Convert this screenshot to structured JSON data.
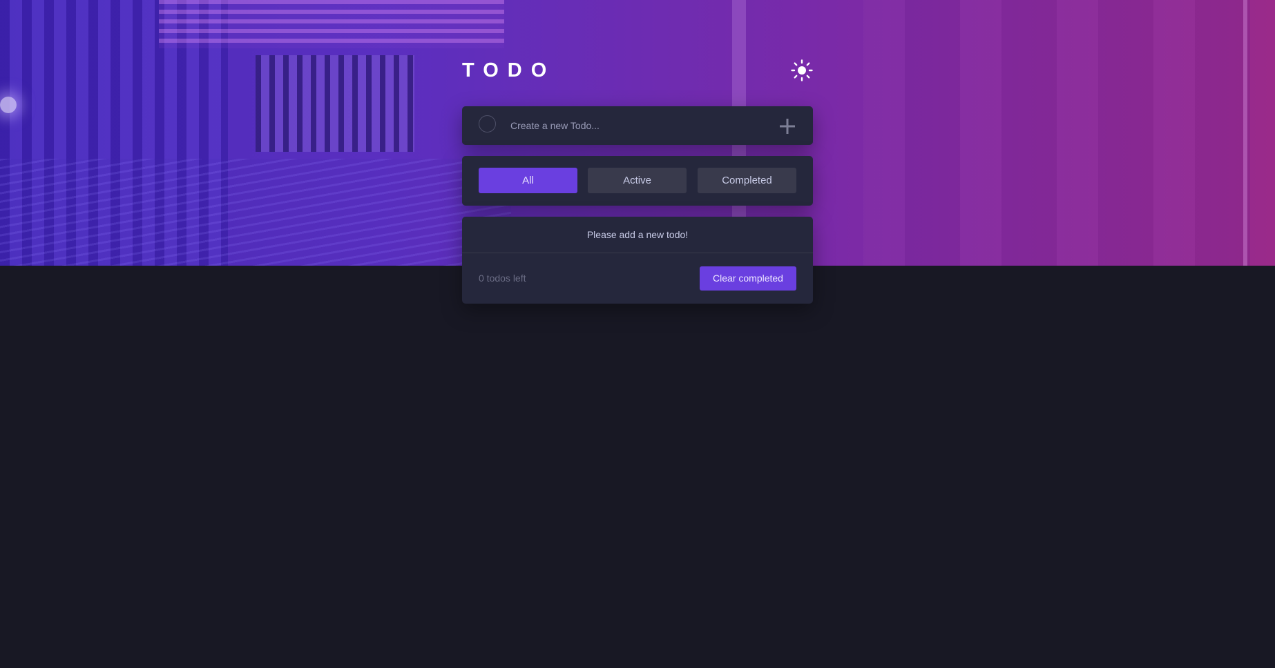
{
  "app": {
    "title": "TODO",
    "theme_toggle_icon": "sun-icon"
  },
  "new_todo": {
    "placeholder": "Create a new Todo...",
    "value": "",
    "add_icon": "plus-icon"
  },
  "filters": {
    "items": [
      {
        "label": "All",
        "active": true
      },
      {
        "label": "Active",
        "active": false
      },
      {
        "label": "Completed",
        "active": false
      }
    ]
  },
  "todo_list": {
    "empty_message": "Please add a new todo!",
    "items_left": "0 todos left",
    "clear_label": "Clear completed"
  },
  "colors": {
    "accent": "#6a3fe0",
    "card_bg": "#25273c",
    "page_bg": "#181824",
    "muted_text": "#6b6d85"
  }
}
